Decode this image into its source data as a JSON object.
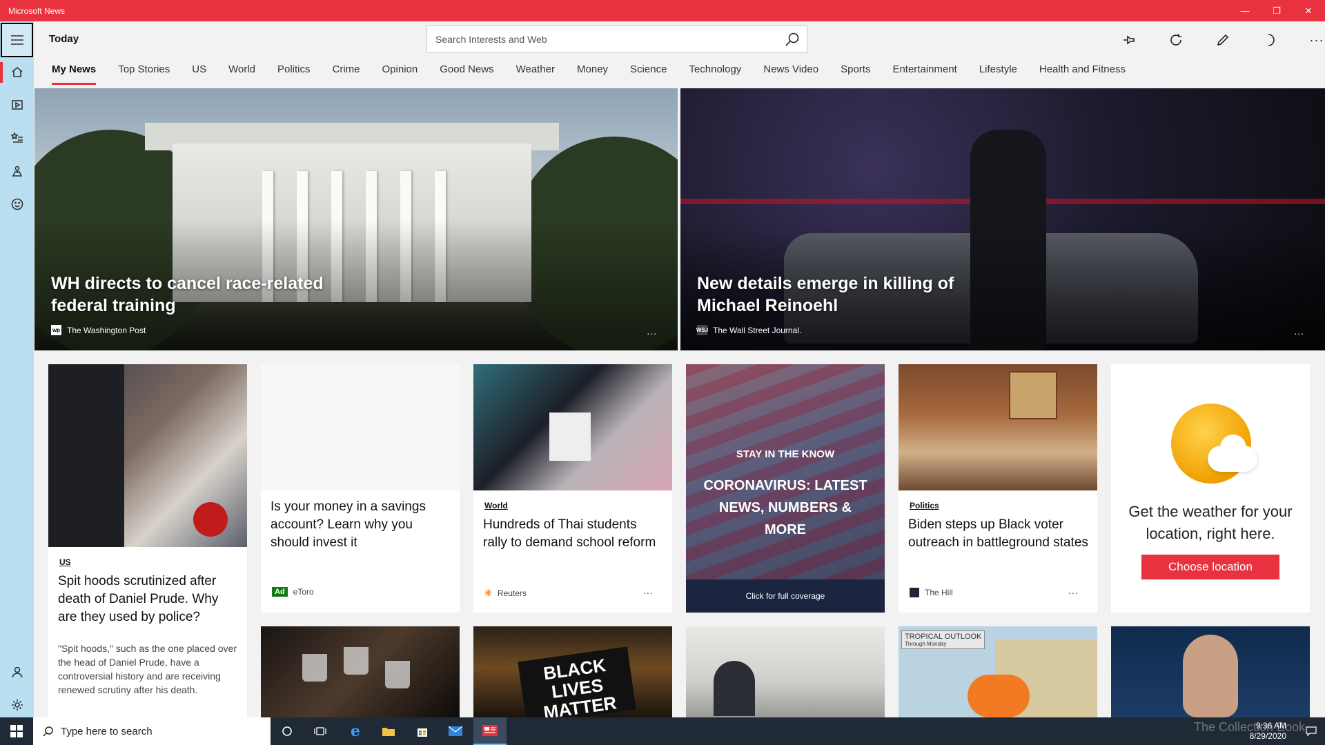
{
  "window": {
    "title": "Microsoft News"
  },
  "header": {
    "page_title": "Today",
    "search_placeholder": "Search Interests and Web"
  },
  "tabs": [
    {
      "label": "My News",
      "active": true
    },
    {
      "label": "Top Stories"
    },
    {
      "label": "US"
    },
    {
      "label": "World"
    },
    {
      "label": "Politics"
    },
    {
      "label": "Crime"
    },
    {
      "label": "Opinion"
    },
    {
      "label": "Good News"
    },
    {
      "label": "Weather"
    },
    {
      "label": "Money"
    },
    {
      "label": "Science"
    },
    {
      "label": "Technology"
    },
    {
      "label": "News Video"
    },
    {
      "label": "Sports"
    },
    {
      "label": "Entertainment"
    },
    {
      "label": "Lifestyle"
    },
    {
      "label": "Health and Fitness"
    }
  ],
  "heroes": [
    {
      "title": "WH directs to cancel race-related federal training",
      "source": "The Washington Post",
      "source_logo": "wp",
      "more": "..."
    },
    {
      "title": "New details emerge in killing of Michael Reinoehl",
      "source": "The Wall Street Journal.",
      "source_logo": "WSJ",
      "more": "..."
    }
  ],
  "cards": {
    "us": {
      "category": "US",
      "headline": "Spit hoods scrutinized after death of Daniel Prude. Why are they used by police?",
      "summary": "\"Spit hoods,\" such as the one placed over the head of Daniel Prude, have a controversial history and are receiving renewed scrutiny after his death."
    },
    "ad": {
      "headline": "Is your money in a savings account? Learn why you should invest it",
      "badge": "Ad",
      "source": "eToro"
    },
    "world": {
      "category": "World",
      "headline": "Hundreds of Thai students rally to demand school reform",
      "source": "Reuters",
      "more": "..."
    },
    "corona": {
      "kicker": "STAY IN THE KNOW",
      "title": "CORONAVIRUS: LATEST NEWS, NUMBERS & MORE",
      "footer": "Click for full coverage"
    },
    "politics": {
      "category": "Politics",
      "headline": "Biden steps up Black voter outreach in battleground states",
      "source": "The Hill",
      "more": "..."
    },
    "weather": {
      "text": "Get the weather for your location, right here.",
      "button": "Choose location"
    },
    "blm_sign": "BLACK LIVES MATTER",
    "tropical": {
      "label": "TROPICAL OUTLOOK",
      "sub": "Through Monday"
    }
  },
  "taskbar": {
    "search_placeholder": "Type here to search",
    "time": "9:36 AM",
    "date": "8/29/2020",
    "watermark": "The Collection Book"
  },
  "colors": {
    "accent": "#e8323f",
    "rail": "#b9dff0",
    "taskbar": "#1f2a36"
  }
}
